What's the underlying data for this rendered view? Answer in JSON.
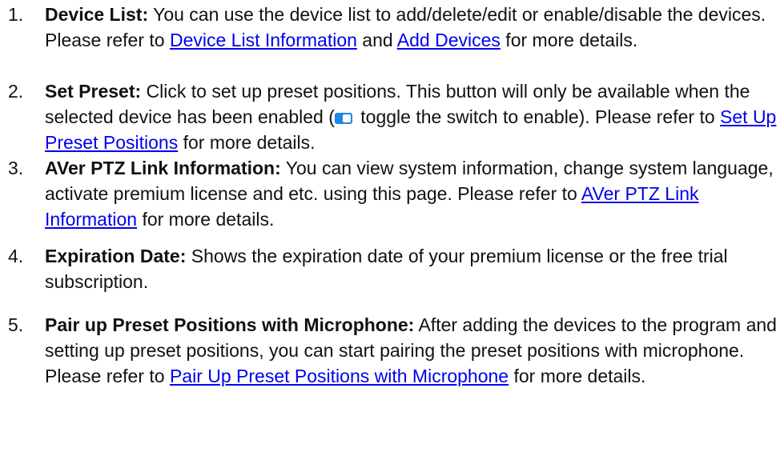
{
  "items": [
    {
      "number": "1.",
      "term": "Device List:",
      "text1": " You can use the device list to add/delete/edit or enable/disable the devices. Please refer to ",
      "link1": "Device List Information",
      "text2": " and ",
      "link2": "Add Devices",
      "text3": " for more details."
    },
    {
      "number": "2.",
      "term": "Set Preset:",
      "text1": " Click to set up preset positions. This button will only be available when the selected device has been enabled (",
      "icon": "toggle-switch-icon",
      "text2": " toggle the switch to enable). Please refer to ",
      "link1": "Set Up Preset Positions",
      "text3": " for more details."
    },
    {
      "number": "3.",
      "term": "AVer PTZ Link Information:",
      "text1": " You can view system information, change system language, activate premium license and etc. using this page. Please refer to ",
      "link1": "AVer PTZ Link Information",
      "text2": " for more details."
    },
    {
      "number": "4.",
      "term": "Expiration Date:",
      "text1": " Shows the expiration date of your premium license or the free trial subscription."
    },
    {
      "number": "5.",
      "term": "Pair up Preset Positions with Microphone:",
      "text1": " After adding the devices to the program and setting up preset positions, you can start pairing the preset positions with microphone. Please refer to ",
      "link1": "Pair Up Preset Positions with Microphone",
      "text2": " for more details."
    }
  ],
  "colors": {
    "link": "#0000ee",
    "toggle": "#1e88e5",
    "text": "#111111"
  }
}
